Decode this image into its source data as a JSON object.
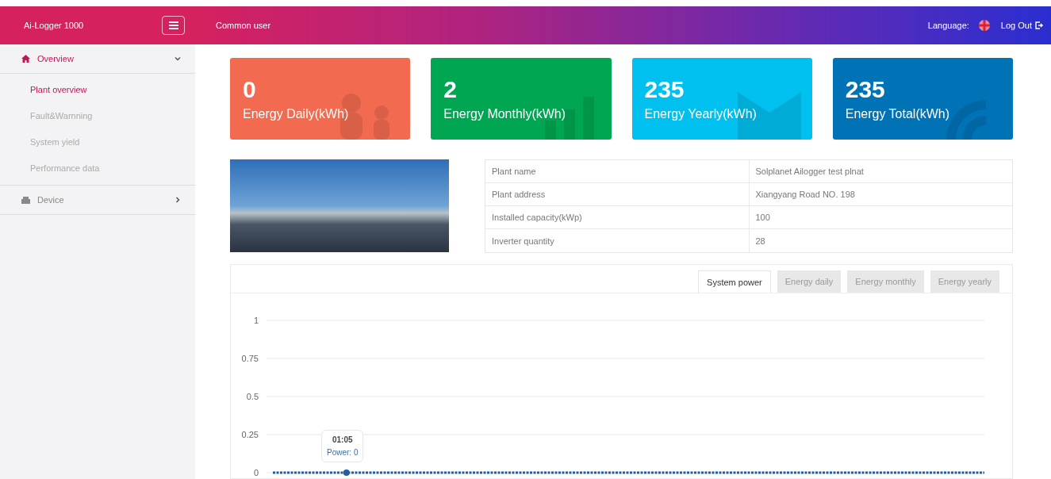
{
  "header": {
    "brand": "Ai-Logger 1000",
    "user": "Common user",
    "language_label": "Language:",
    "logout": "Log Out"
  },
  "sidebar": {
    "items": [
      {
        "label": "Overview",
        "expanded": true,
        "selected": true,
        "children": [
          {
            "label": "Plant overview",
            "selected": true
          },
          {
            "label": "Fault&Warnning",
            "selected": false
          },
          {
            "label": "System yield",
            "selected": false
          },
          {
            "label": "Performance data",
            "selected": false
          }
        ]
      },
      {
        "label": "Device",
        "expanded": false,
        "selected": false
      }
    ]
  },
  "stat_cards": [
    {
      "value": "0",
      "label": "Energy Daily(kWh)",
      "color": "#f26a50"
    },
    {
      "value": "2",
      "label": "Energy Monthly(kWh)",
      "color": "#00a651"
    },
    {
      "value": "235",
      "label": "Energy Yearly(kWh)",
      "color": "#00c0ef"
    },
    {
      "value": "235",
      "label": "Energy Total(kWh)",
      "color": "#0073b7"
    }
  ],
  "plant_info": [
    {
      "label": "Plant name",
      "value": "Solplanet Ailogger test plnat"
    },
    {
      "label": "Plant address",
      "value": "Xiangyang Road NO. 198"
    },
    {
      "label": "Installed capacity(kWp)",
      "value": "100"
    },
    {
      "label": "Inverter quantity",
      "value": "28"
    }
  ],
  "chart_tabs": [
    {
      "label": "System power",
      "selected": true
    },
    {
      "label": "Energy daily",
      "selected": false
    },
    {
      "label": "Energy monthly",
      "selected": false
    },
    {
      "label": "Energy yearly",
      "selected": false
    }
  ],
  "chart_data": {
    "type": "line",
    "grid": true,
    "ylim": [
      0,
      1
    ],
    "yticks": [
      0,
      0.25,
      0.5,
      0.75,
      1
    ],
    "series": [
      {
        "color": "#1f5f9e",
        "line_style": "dotted",
        "values": [
          0,
          0,
          0,
          0,
          0,
          0,
          0,
          0,
          0,
          0,
          0,
          0,
          0,
          0,
          0,
          0,
          0,
          0,
          0,
          0,
          0,
          0,
          0,
          0,
          0,
          0,
          0,
          0,
          0,
          0
        ]
      }
    ]
  },
  "tooltip": {
    "time": "01:05",
    "reading": "Power: 0"
  }
}
